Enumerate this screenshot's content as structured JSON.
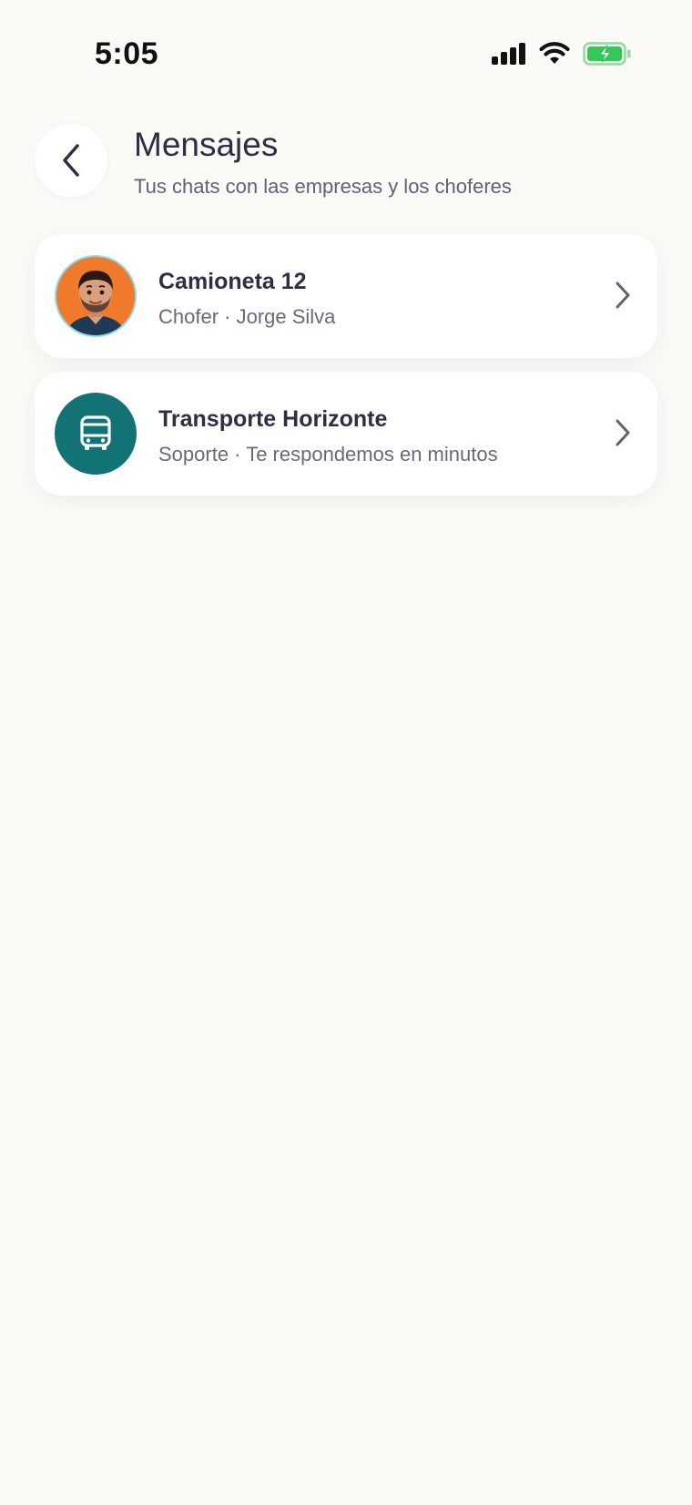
{
  "status_bar": {
    "time": "5:05",
    "icons": [
      "cellular-signal-icon",
      "wifi-icon",
      "battery-charging-icon"
    ]
  },
  "header": {
    "back_icon": "chevron-left-icon",
    "title": "Mensajes",
    "subtitle": "Tus chats con las empresas y los choferes"
  },
  "chats": [
    {
      "name": "Camioneta 12",
      "subtitle": "Chofer · Jorge Silva",
      "avatar": "driver-portrait-avatar"
    },
    {
      "name": "Transporte Horizonte",
      "subtitle": "Soporte · Te respondemos en minutos",
      "avatar": "bus-icon"
    }
  ],
  "colors": {
    "background": "#fbfaf7",
    "card": "#ffffff",
    "accent_teal": "#137276",
    "battery_green": "#34c759",
    "avatar_orange": "#f07a2c"
  }
}
